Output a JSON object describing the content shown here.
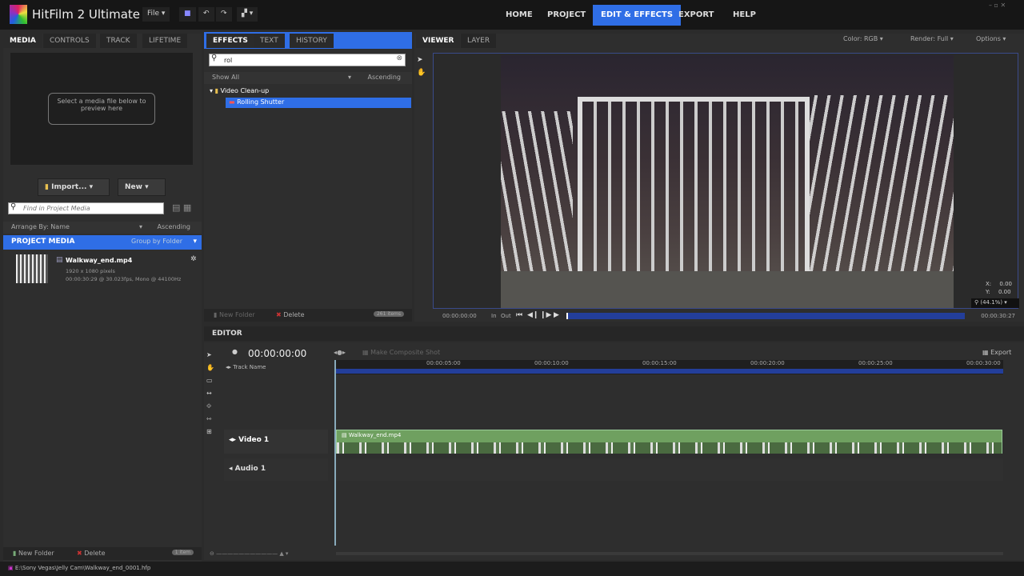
{
  "app": {
    "title": "HitFilm 2 Ultimate",
    "file_menu": "File"
  },
  "nav": [
    "HOME",
    "PROJECT",
    "EDIT & EFFECTS",
    "EXPORT",
    "HELP"
  ],
  "left_tabs": [
    "MEDIA",
    "CONTROLS",
    "TRACK",
    "LIFETIME"
  ],
  "media": {
    "preview_hint": "Select a media file below to preview here",
    "import": "Import...",
    "new": "New",
    "search_placeholder": "Find in Project Media",
    "arrange": "Arrange By: Name",
    "order": "Ascending",
    "project_media": "PROJECT MEDIA",
    "group": "Group by Folder",
    "item": {
      "name": "Walkway_end.mp4",
      "res": "1920 x 1080 pixels",
      "info": "00:00:30:29 @ 30.023fps, Mono @ 44100Hz"
    },
    "new_folder": "New Folder",
    "delete": "Delete",
    "count": "1 item"
  },
  "effects": {
    "tabs": [
      "EFFECTS",
      "TEXT",
      "HISTORY"
    ],
    "search": "rol",
    "filter": "Show All",
    "order": "Ascending",
    "folder": "Video Clean-up",
    "item": "Rolling Shutter",
    "new_folder": "New Folder",
    "delete": "Delete",
    "count": "261 items"
  },
  "viewer": {
    "tabs": [
      "VIEWER",
      "LAYER"
    ],
    "color": "Color: RGB",
    "render": "Render: Full",
    "options": "Options",
    "x": "X:",
    "xv": "0.00",
    "y": "Y:",
    "yv": "0.00",
    "zoom": "(44.1%)",
    "time_start": "00:00:00:00",
    "in": "In",
    "out": "Out",
    "time_end": "00:00:30:27",
    "progress": 0
  },
  "editor": {
    "title": "EDITOR",
    "timecode": "00:00:00:00",
    "composite": "Make Composite Shot",
    "export": "Export",
    "track_name": "Track Name",
    "ticks": [
      "00:00:05:00",
      "00:00:10:00",
      "00:00:15:00",
      "00:00:20:00",
      "00:00:25:00",
      "00:00:30:00"
    ],
    "video_track": "Video 1",
    "audio_track": "Audio 1",
    "clip": "Walkway_end.mp4"
  },
  "status": {
    "path": "E:\\Sony Vegas\\Jelly Cam\\Walkway_end_0001.hfp"
  },
  "colors": {
    "accent": "#2f6ee6",
    "clip": "#6fa060"
  }
}
